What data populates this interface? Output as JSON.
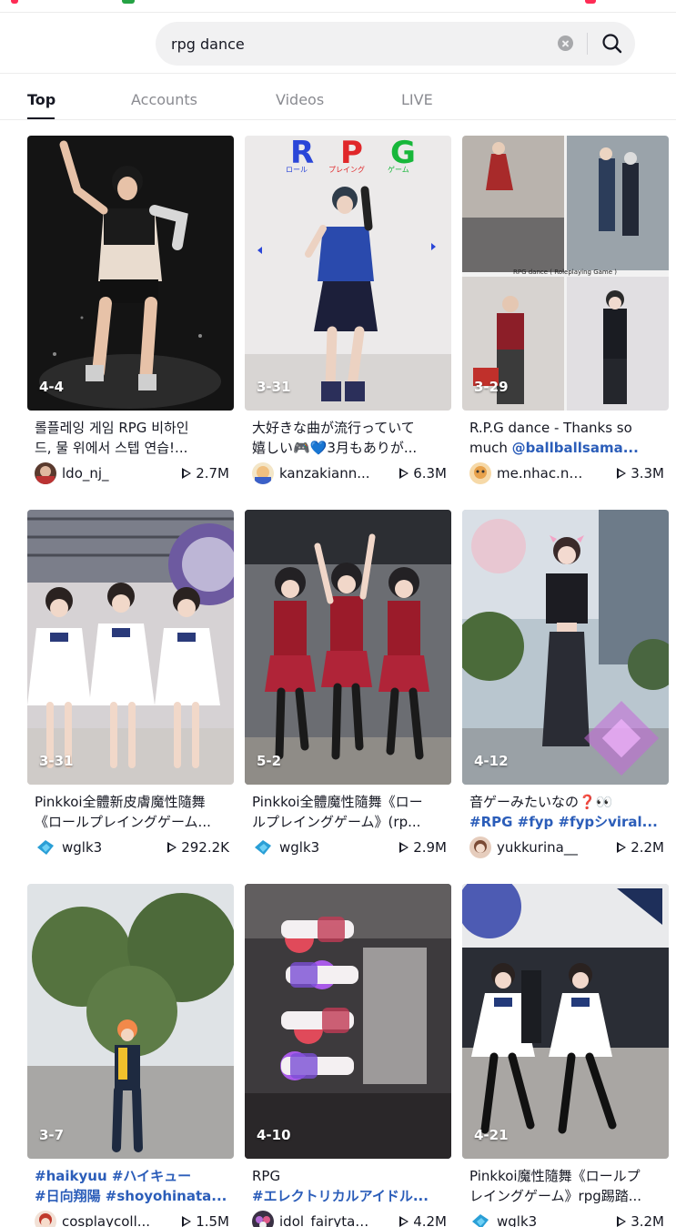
{
  "search": {
    "query": "rpg dance"
  },
  "tabs": [
    "Top",
    "Accounts",
    "Videos",
    "LIVE"
  ],
  "videos": [
    {
      "date": "4-4",
      "desc": [
        "롤플레잉 게임 RPG 비하인",
        "드, 물 위에서 스텝 연습!..."
      ],
      "user": "ldo_nj_",
      "views": "2.7M"
    },
    {
      "date": "3-31",
      "desc": [
        "大好きな曲が流行っていて",
        "嬉しい🎮💙3月もありが..."
      ],
      "user": "kanzakiann...",
      "views": "6.3M"
    },
    {
      "date": "3-29",
      "desc": [
        "R.P.G dance - Thanks so",
        "much "
      ],
      "mention": "@ballballsama...",
      "user": "me.nhac.nh...",
      "views": "3.3M"
    },
    {
      "date": "3-31",
      "desc": [
        "Pinkkoi全體新皮膚魔性隨舞",
        "《ロールプレイングゲーム..."
      ],
      "user": "wglk3",
      "views": "292.2K"
    },
    {
      "date": "5-2",
      "desc": [
        "Pinkkoi全體魔性隨舞《ロー",
        "ルプレイングゲーム》(rp..."
      ],
      "user": "wglk3",
      "views": "2.9M"
    },
    {
      "date": "4-12",
      "desc": [
        "音ゲーみたいなの❓👀",
        "#RPG #fyp #fypシviral..."
      ],
      "user": "yukkurina__",
      "views": "2.2M"
    },
    {
      "date": "3-7",
      "desc": [
        "#haikyuu #ハイキュー",
        "#日向翔陽 #shoyohinata..."
      ],
      "user": "cosplaycoll...",
      "views": "1.5M"
    },
    {
      "date": "4-10",
      "desc": [
        "RPG",
        "#エレクトリカルアイドル..."
      ],
      "user": "idol_fairytales",
      "views": "4.2M"
    },
    {
      "date": "4-21",
      "desc": [
        "Pinkkoi魔性隨舞《ロールプ",
        "レイングゲーム》rpg踢踏..."
      ],
      "user": "wglk3",
      "views": "3.2M"
    }
  ],
  "thumb_text": {
    "rpg_letters": [
      "R",
      "P",
      "G"
    ],
    "rpg_sub": [
      "ロール",
      "プレイング",
      "ゲーム"
    ],
    "caption3": "RPG dance ( Roleplaying Game )"
  }
}
